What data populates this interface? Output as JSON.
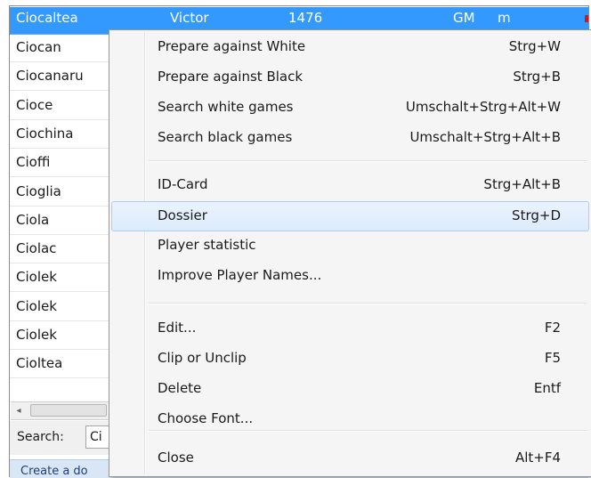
{
  "list": {
    "selected_row": {
      "name": "Ciocaltea",
      "first_name": "Victor",
      "elo": "1476",
      "title": "GM",
      "sex": "m"
    },
    "rows": [
      "Ciocan",
      "Ciocanaru",
      "Cioce",
      "Ciochina",
      "Cioffi",
      "Cioglia",
      "Ciola",
      "Ciolac",
      "Ciolek",
      "Ciolek",
      "Ciolek",
      "Cioltea"
    ],
    "edge_mark_colors": [
      "#d01818",
      "#e8c000",
      "#c01818",
      "#c01818",
      "#c01818",
      "#c01818",
      "#20a020",
      "#c01818",
      "#c01818",
      "#c01818",
      "#c01818",
      "#c01818",
      "#c01818"
    ]
  },
  "scrollbar": {
    "left_arrow": "◂"
  },
  "search": {
    "label": "Search:",
    "value": "Ci"
  },
  "status_bar": {
    "text": "Create a do"
  },
  "context_menu": {
    "groups": [
      [
        {
          "label": "Prepare against White",
          "shortcut": "Strg+W"
        },
        {
          "label": "Prepare against Black",
          "shortcut": "Strg+B"
        },
        {
          "label": "Search white games",
          "shortcut": "Umschalt+Strg+Alt+W"
        },
        {
          "label": "Search black games",
          "shortcut": "Umschalt+Strg+Alt+B"
        }
      ],
      [
        {
          "label": "ID-Card",
          "shortcut": "Strg+Alt+B"
        },
        {
          "label": "Dossier",
          "shortcut": "Strg+D",
          "highlighted": true
        },
        {
          "label": "Player statistic",
          "shortcut": ""
        },
        {
          "label": "Improve Player Names...",
          "shortcut": ""
        }
      ],
      [
        {
          "label": "Edit...",
          "shortcut": "F2"
        },
        {
          "label": "Clip or Unclip",
          "shortcut": "F5"
        },
        {
          "label": "Delete",
          "shortcut": "Entf"
        },
        {
          "label": "Choose Font...",
          "shortcut": ""
        }
      ],
      [
        {
          "label": "Close",
          "shortcut": "Alt+F4"
        }
      ]
    ]
  },
  "colors": {
    "selection": "#3399ff",
    "menu_background": "#f5f5f5",
    "menu_highlight": "#dcebfc"
  }
}
